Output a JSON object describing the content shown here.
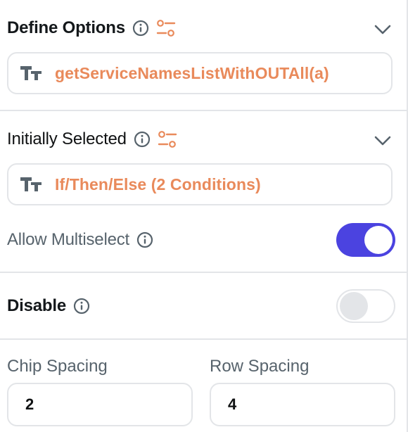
{
  "define_options": {
    "title": "Define Options",
    "value": "getServiceNamesListWithOUTAll(a)"
  },
  "initially_selected": {
    "title": "Initially Selected",
    "value": "If/Then/Else (2 Conditions)"
  },
  "allow_multiselect": {
    "label": "Allow Multiselect",
    "enabled": true
  },
  "disable": {
    "label": "Disable",
    "enabled": false
  },
  "chip_spacing": {
    "label": "Chip Spacing",
    "value": "2"
  },
  "row_spacing": {
    "label": "Row Spacing",
    "value": "4"
  },
  "colors": {
    "accent_orange": "#e98a5b",
    "toggle_on": "#4b43e0",
    "border": "#e3e5e8",
    "muted_text": "#57636c"
  },
  "icons": {
    "info": "info-icon",
    "tune": "tune-icon",
    "chevron": "chevron-down-icon",
    "text_type": "text-type-icon"
  }
}
